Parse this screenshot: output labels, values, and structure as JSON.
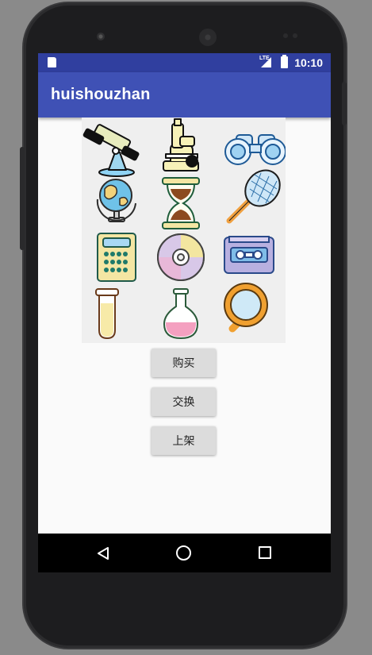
{
  "status_bar": {
    "network": "LTE",
    "time": "10:10"
  },
  "app_bar": {
    "title": "huishouzhan"
  },
  "item_icons": [
    "telescope-icon",
    "microscope-icon",
    "binoculars-icon",
    "globe-icon",
    "hourglass-icon",
    "butterfly-net-icon",
    "calculator-icon",
    "cd-disc-icon",
    "cassette-tape-icon",
    "test-tube-icon",
    "flask-icon",
    "magnifier-icon"
  ],
  "buttons": {
    "buy": "购买",
    "exchange": "交换",
    "list": "上架"
  },
  "colors": {
    "status_bar": "#303f9f",
    "app_bar": "#3f51b5",
    "button": "#dcdcdc"
  },
  "nav_bar": [
    "back-icon",
    "home-icon",
    "recent-apps-icon"
  ]
}
